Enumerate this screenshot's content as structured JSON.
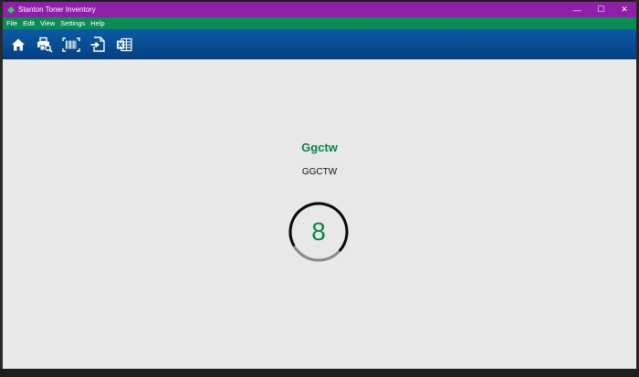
{
  "window": {
    "title": "Stanton Toner Inventory",
    "controls": {
      "minimize": "—",
      "maximize": "☐",
      "close": "✕"
    }
  },
  "menu": {
    "items": [
      {
        "label": "File"
      },
      {
        "label": "Edit"
      },
      {
        "label": "View"
      },
      {
        "label": "Settings"
      },
      {
        "label": "Help"
      }
    ]
  },
  "toolbar": {
    "buttons": [
      {
        "icon": "home-icon"
      },
      {
        "icon": "printer-search-icon"
      },
      {
        "icon": "barcode-scan-icon"
      },
      {
        "icon": "import-file-icon"
      },
      {
        "icon": "excel-export-icon"
      }
    ]
  },
  "item": {
    "title": "Ggctw",
    "code": "GGCTW",
    "count": "8",
    "progress": 0.3
  },
  "colors": {
    "titlebar": "#8e1fa6",
    "menubar": "#0c8c55",
    "toolbar": "#084f96",
    "accent_green": "#0c8247",
    "background": "#e8e8e8"
  }
}
